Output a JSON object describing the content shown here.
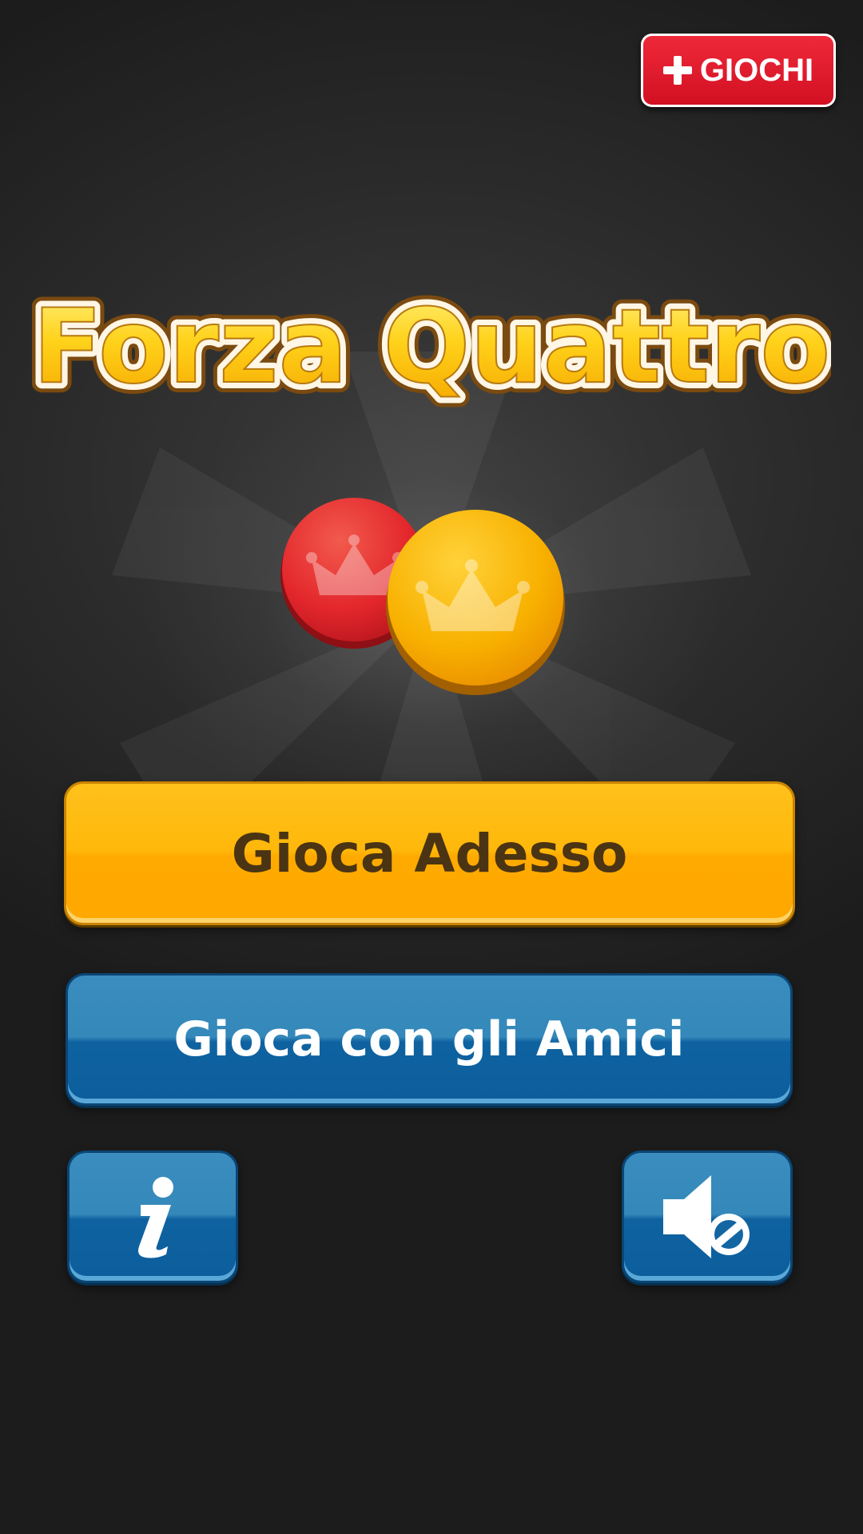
{
  "top_bar": {
    "more_games_label": "GIOCHI",
    "more_games_icon": "plus-icon"
  },
  "title": {
    "text": "Forza Quattro"
  },
  "logo": {
    "chips": [
      "red-chip",
      "yellow-chip"
    ],
    "icon": "crown-icon"
  },
  "menu": {
    "play_now_label": "Gioca Adesso",
    "play_friends_label": "Gioca con gli Amici"
  },
  "footer_buttons": {
    "info_icon": "info-icon",
    "sound_icon": "sound-muted-icon"
  },
  "colors": {
    "background": "#262626",
    "title_fill": "#ffd21a",
    "title_outline": "#ffffff",
    "primary_button": "#ffb300",
    "primary_button_text": "#4a3413",
    "secondary_button": "#1d6fa8",
    "secondary_button_text": "#ffffff",
    "more_games_button": "#e2182b",
    "red_chip": "#e3272c",
    "yellow_chip": "#f6a800"
  }
}
